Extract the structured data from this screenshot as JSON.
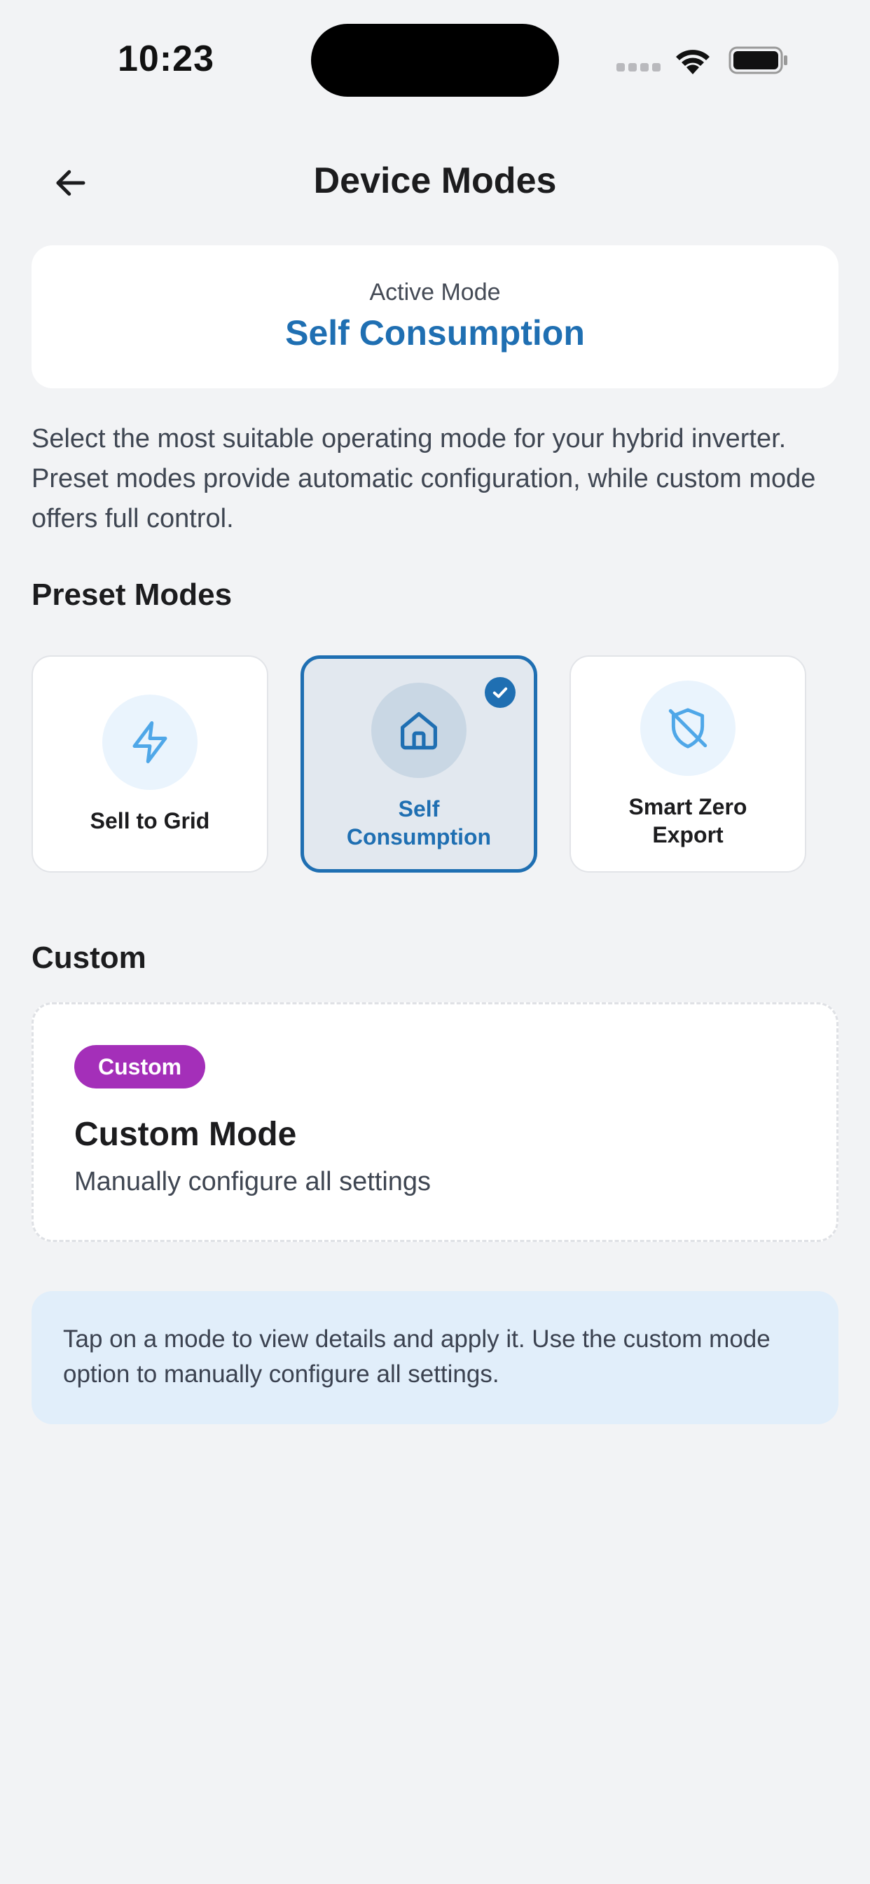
{
  "status_bar": {
    "time": "10:23"
  },
  "header": {
    "title": "Device Modes"
  },
  "active_mode": {
    "label": "Active Mode",
    "value": "Self Consumption",
    "color": "#1f6fb2"
  },
  "description": "Select the most suitable operating mode for your hybrid inverter. Preset modes provide automatic configuration, while custom mode offers full control.",
  "preset_section": {
    "title": "Preset Modes",
    "modes": [
      {
        "label": "Sell to Grid",
        "icon": "lightning-icon",
        "selected": false
      },
      {
        "label": "Self Consumption",
        "icon": "home-icon",
        "selected": true
      },
      {
        "label": "Smart Zero Export",
        "icon": "shield-off-icon",
        "selected": false
      }
    ]
  },
  "custom_section": {
    "title": "Custom",
    "badge": "Custom",
    "heading": "Custom Mode",
    "subtitle": "Manually configure all settings",
    "badge_color": "#a42fb9"
  },
  "info": {
    "text": "Tap on a mode to view details and apply it. Use the custom mode option to manually configure all settings."
  }
}
